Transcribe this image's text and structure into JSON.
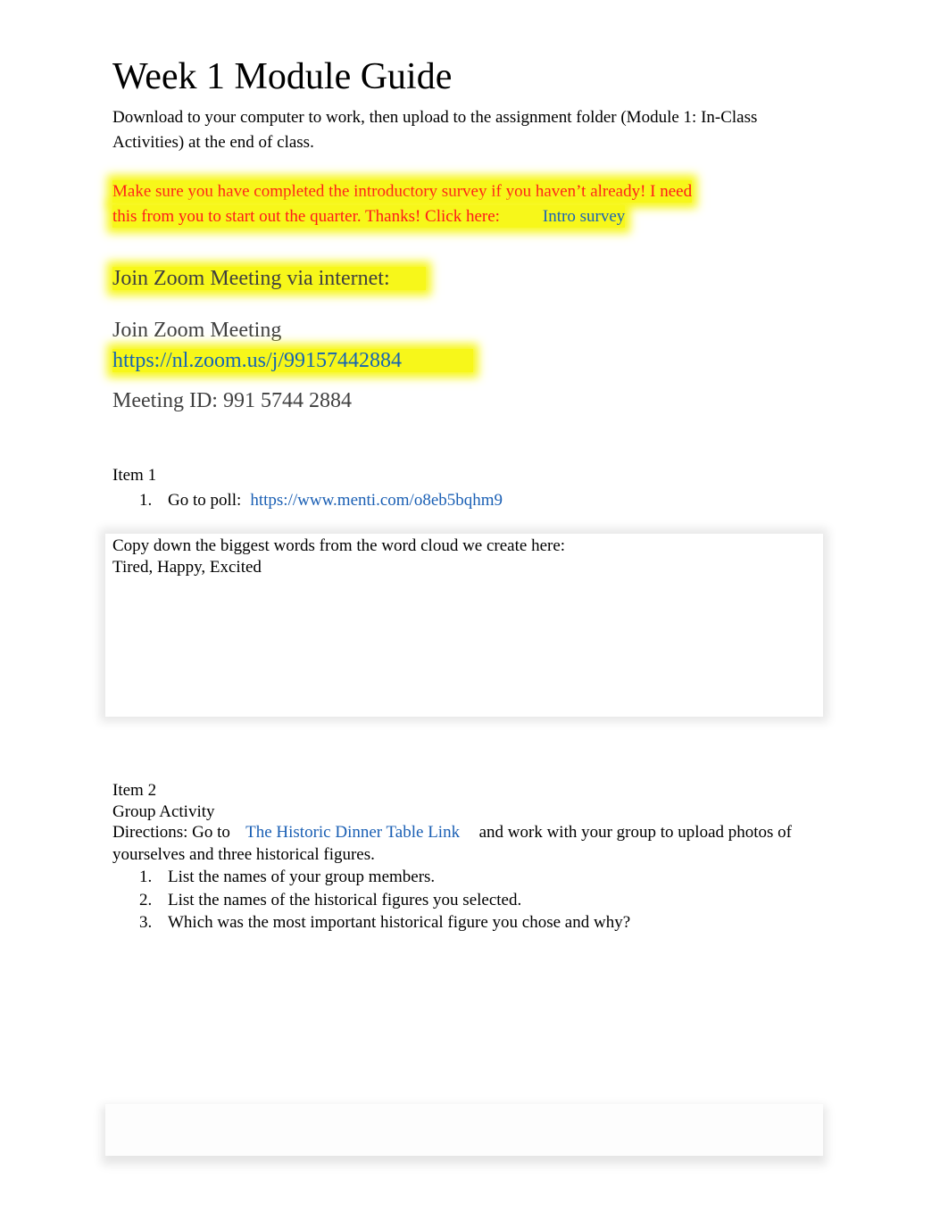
{
  "document": {
    "title": "Week 1 Module Guide",
    "intro": "Download to your computer to work, then upload to the assignment folder (Module 1: In-Class Activities) at the end of class.",
    "notice": {
      "line1": "Make sure you have completed the introductory survey if you haven’t already! I need",
      "line2": "this from you to start out the quarter. Thanks! Click here:",
      "link_label": "Intro survey"
    },
    "zoom": {
      "heading": "Join Zoom Meeting via internet:",
      "label": "Join Zoom Meeting",
      "url": "https://nl.zoom.us/j/99157442884",
      "meeting_id": "Meeting ID: 991 5744 2884"
    },
    "item1": {
      "heading": "Item 1",
      "steps": [
        {
          "num": "1.",
          "text": "Go to poll:",
          "link": "https://www.menti.com/o8eb5bqhm9"
        }
      ],
      "answer_box": {
        "prompt": "Copy down the biggest words from the word cloud we create here:",
        "answer": "Tired, Happy, Excited"
      }
    },
    "item2": {
      "heading": "Item 2",
      "subheading": "Group Activity",
      "directions_prefix": "Directions: Go to",
      "directions_link": "The Historic Dinner Table Link",
      "directions_suffix": "and work with your group to upload photos of",
      "directions_line2": "yourselves and three historical figures.",
      "steps": [
        {
          "num": "1.",
          "text": "List the names of your group members."
        },
        {
          "num": "2.",
          "text": "List the names of the historical figures you selected."
        },
        {
          "num": "3.",
          "text": "Which was the most important historical figure you chose and why?"
        }
      ]
    },
    "colors": {
      "highlight": "#f7f71a",
      "notice_text": "#ff1a1a",
      "link": "#1a5fb4"
    }
  }
}
